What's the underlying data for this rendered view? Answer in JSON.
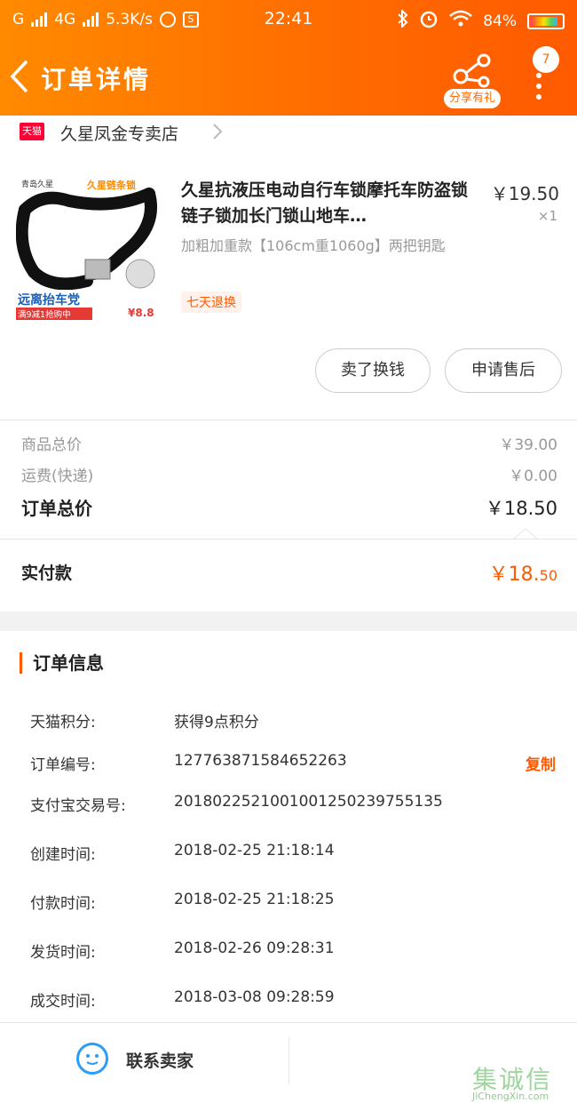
{
  "status_bar": {
    "carrier": "G",
    "network": "4G",
    "speed": "5.3K/s",
    "time": "22:41",
    "battery": "84%"
  },
  "nav": {
    "title": "订单详情",
    "share_label": "分享有礼",
    "badge_count": "7"
  },
  "shop": {
    "platform_badge": "天猫",
    "name": "久星凤金专卖店"
  },
  "product": {
    "title": "久星抗液压电动自行车锁摩托车防盗锁链子锁加长门锁山地车…",
    "spec": "加粗加重款【106cm重1060g】两把钥匙",
    "price": "￥19.50",
    "quantity": "×1",
    "tag": "七天退换",
    "image_text": {
      "brand": "青岛久星",
      "top_right": "久星链条锁",
      "bottom_title": "远离抬车党",
      "promo": "满9减1抢购中",
      "price_mark": "¥8.8"
    }
  },
  "actions": {
    "sell_label": "卖了换钱",
    "after_sale_label": "申请售后"
  },
  "costs": {
    "goods_total_label": "商品总价",
    "goods_total_value": "￥39.00",
    "shipping_label": "运费(快递)",
    "shipping_value": "￥0.00",
    "order_total_label": "订单总价",
    "order_total_value": "￥18.50",
    "paid_label": "实付款",
    "paid_value_main": "￥18.",
    "paid_value_cents": "50"
  },
  "order_info": {
    "heading": "订单信息",
    "rows": [
      {
        "key": "天猫积分:",
        "value": "获得9点积分"
      },
      {
        "key": "订单编号:",
        "value": "127763871584652263",
        "action": "复制"
      },
      {
        "key": "支付宝交易号:",
        "value": "2018022521001001250239755135"
      },
      {
        "key": "创建时间:",
        "value": "2018-02-25 21:18:14"
      },
      {
        "key": "付款时间:",
        "value": "2018-02-25 21:18:25"
      },
      {
        "key": "发货时间:",
        "value": "2018-02-26 09:28:31"
      },
      {
        "key": "成交时间:",
        "value": "2018-03-08 09:28:59"
      }
    ]
  },
  "bottom_bar": {
    "contact_label": "联系卖家",
    "watermark_cn": "集诚信",
    "watermark_en": "JiChengXin.com"
  },
  "colors": {
    "header_orange": "#ff6a00",
    "accent": "#ff5a00",
    "tmall_red": "#ff0036",
    "contact_blue": "#2a9df4"
  }
}
